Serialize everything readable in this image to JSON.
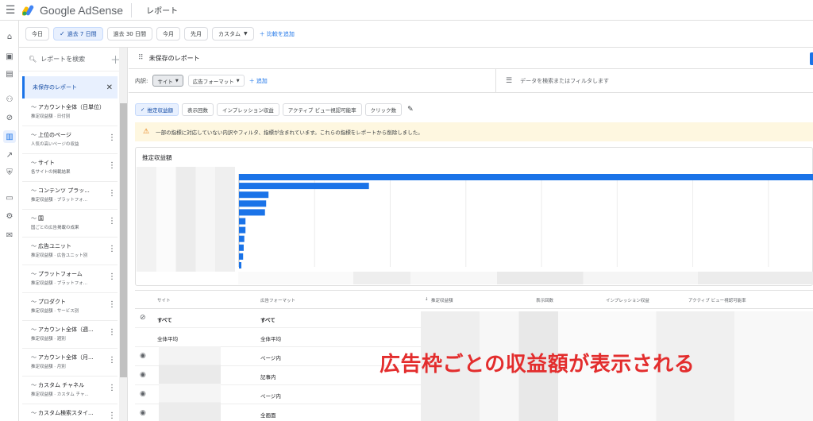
{
  "app": {
    "brand": "Google AdSense",
    "page_title": "レポート",
    "logo_colors": [
      "#fbbc04",
      "#34a853",
      "#4285f4"
    ]
  },
  "date_range": {
    "chips": [
      {
        "label": "今日",
        "selected": false
      },
      {
        "label": "過去 7 日間",
        "selected": true
      },
      {
        "label": "過去 30 日間",
        "selected": false
      },
      {
        "label": "今月",
        "selected": false
      },
      {
        "label": "先月",
        "selected": false
      },
      {
        "label": "カスタム",
        "selected": false
      }
    ],
    "compare_label": "比較を追加"
  },
  "sidebar": {
    "search_placeholder": "レポートを検索",
    "unsaved_label": "未保存のレポート",
    "reports": [
      {
        "title": "アカウント全体（日単位）",
        "sub": "推定収益額 · 日付別",
        "menu": false
      },
      {
        "title": "上位のページ",
        "sub": "人気の高いページの収益",
        "menu": true
      },
      {
        "title": "サイト",
        "sub": "各サイトの掲載結果",
        "menu": true
      },
      {
        "title": "コンテンツ プラッ...",
        "sub": "推定収益額 · プラットフォ...",
        "menu": true
      },
      {
        "title": "国",
        "sub": "国ごとの広告掲載の成果",
        "menu": true
      },
      {
        "title": "広告ユニット",
        "sub": "推定収益額 · 広告ユニット別",
        "menu": true
      },
      {
        "title": "プラットフォーム",
        "sub": "推定収益額 · プラットフォ...",
        "menu": true
      },
      {
        "title": "プロダクト",
        "sub": "推定収益額 · サービス別",
        "menu": true
      },
      {
        "title": "アカウント全体（週...",
        "sub": "推定収益額 · 週別",
        "menu": true
      },
      {
        "title": "アカウント全体（月...",
        "sub": "推定収益額 · 月別",
        "menu": true
      },
      {
        "title": "カスタム チャネル",
        "sub": "推定収益額 · カスタム チャ...",
        "menu": true
      },
      {
        "title": "カスタム検索スタイ...",
        "sub": "",
        "menu": true
      }
    ]
  },
  "report": {
    "title": "未保存のレポート",
    "breakdown_label": "内訳:",
    "dims": [
      "サイト",
      "広告フォーマット"
    ],
    "add_label": "追加",
    "filter_placeholder": "データを検索またはフィルタします",
    "metrics": [
      {
        "label": "推定収益額",
        "selected": true
      },
      {
        "label": "表示回数",
        "selected": false
      },
      {
        "label": "インプレッション収益",
        "selected": false
      },
      {
        "label": "アクティブ ビュー視認可能率",
        "selected": false
      },
      {
        "label": "クリック数",
        "selected": false
      }
    ],
    "warning": "一部の指標に対応していない内訳やフィルタ、指標が含まれています。これらの指標をレポートから削除しました。"
  },
  "chart_data": {
    "type": "bar",
    "orientation": "horizontal",
    "title": "推定収益額",
    "values": [
      100,
      22,
      5,
      4.6,
      4.4,
      1.1,
      1.1,
      0.9,
      0.8,
      0.7,
      0.4
    ],
    "color": "#1a73e8",
    "grid": true
  },
  "table": {
    "headers": [
      "サイト",
      "広告フォーマット",
      "推定収益額",
      "表示回数",
      "インプレッション収益",
      "アクティブ ビュー視認可能率"
    ],
    "rows": [
      {
        "site": "すべて",
        "format": "すべて",
        "bold": true,
        "icon": "eye-off"
      },
      {
        "site": "全体平均",
        "format": "全体平均",
        "bold": false,
        "icon": ""
      },
      {
        "site": "",
        "format": "ページ内",
        "bold": false,
        "icon": "eye"
      },
      {
        "site": "",
        "format": "記事内",
        "bold": false,
        "icon": "eye"
      },
      {
        "site": "",
        "format": "ページ内",
        "bold": false,
        "icon": "eye"
      },
      {
        "site": "",
        "format": "全画面",
        "bold": false,
        "icon": "eye"
      }
    ]
  },
  "callout": "広告枠ごとの収益額が表示される"
}
